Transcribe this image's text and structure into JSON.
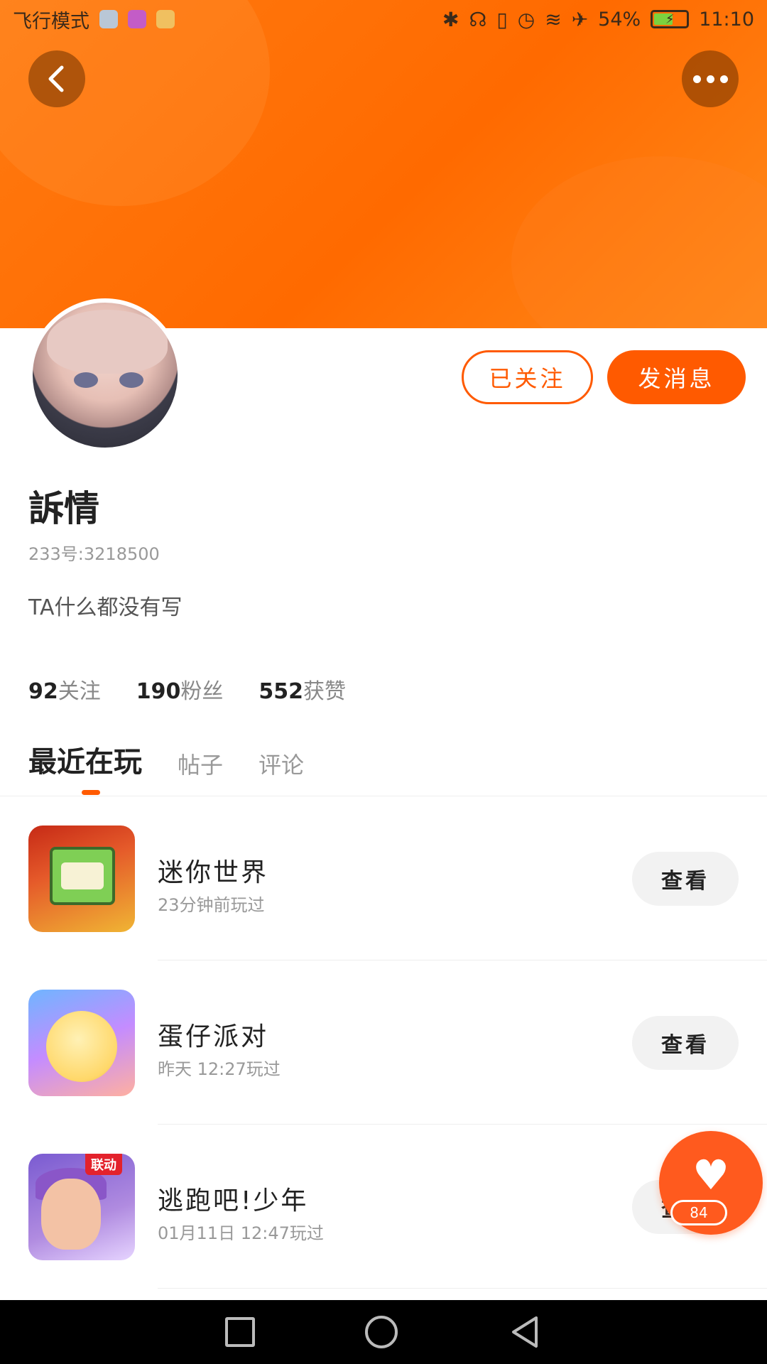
{
  "status_bar": {
    "mode": "飞行模式",
    "battery": "54%",
    "time": "11:10"
  },
  "header": {
    "back_icon": "chevron-left-icon",
    "more_icon": "more-dots-icon"
  },
  "profile": {
    "followed_label": "已关注",
    "message_label": "发消息",
    "name": "訴情",
    "uid": "233号:3218500",
    "bio": "TA什么都没有写",
    "stats": [
      {
        "num": "92",
        "label": "关注"
      },
      {
        "num": "190",
        "label": "粉丝"
      },
      {
        "num": "552",
        "label": "获赞"
      }
    ]
  },
  "tabs": [
    {
      "label": "最近在玩"
    },
    {
      "label": "帖子"
    },
    {
      "label": "评论"
    }
  ],
  "games": [
    {
      "name": "迷你世界",
      "time": "23分钟前玩过",
      "button": "查看"
    },
    {
      "name": "蛋仔派对",
      "time": "昨天 12:27玩过",
      "button": "查看"
    },
    {
      "name": "逃跑吧!少年",
      "time": "01月11日 12:47玩过",
      "button": "查看",
      "tag": "联动"
    }
  ],
  "like_fab": {
    "icon": "heart-icon",
    "count": "84"
  },
  "colors": {
    "accent": "#ff5a00",
    "banner": "#ff7a10"
  }
}
